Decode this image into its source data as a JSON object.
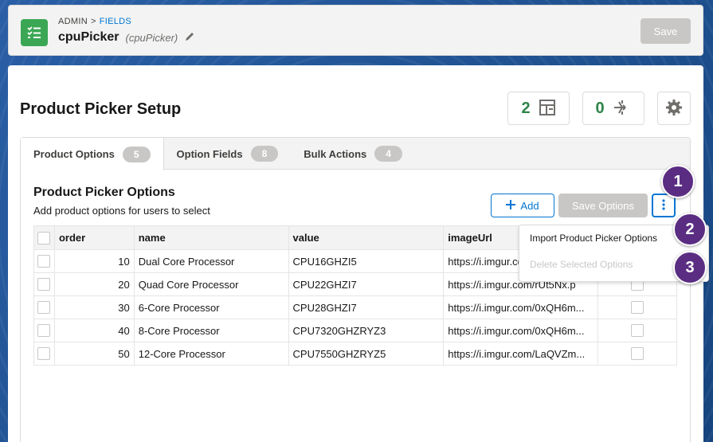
{
  "header": {
    "breadcrumb_root": "ADMIN",
    "breadcrumb_sep": ">",
    "breadcrumb_current": "FIELDS",
    "title": "cpuPicker",
    "api_name": "(cpuPicker)",
    "save_label": "Save"
  },
  "card": {
    "title": "Product Picker Setup",
    "stat_layout": "2",
    "stat_flows": "0"
  },
  "tabs": [
    {
      "label": "Product Options",
      "count": "5"
    },
    {
      "label": "Option Fields",
      "count": "8"
    },
    {
      "label": "Bulk Actions",
      "count": "4"
    }
  ],
  "section": {
    "title": "Product Picker Options",
    "subtitle": "Add product options for users to select",
    "add_label": "Add",
    "save_label": "Save Options"
  },
  "table": {
    "columns": [
      "order",
      "name",
      "value",
      "imageUrl"
    ],
    "rows": [
      {
        "order": "10",
        "name": "Dual Core Processor",
        "value": "CPU16GHZI5",
        "imageUrl": "https://i.imgur.com/"
      },
      {
        "order": "20",
        "name": "Quad Core Processor",
        "value": "CPU22GHZI7",
        "imageUrl": "https://i.imgur.com/rUt5Nx.p"
      },
      {
        "order": "30",
        "name": "6-Core Processor",
        "value": "CPU28GHZI7",
        "imageUrl": "https://i.imgur.com/0xQH6m..."
      },
      {
        "order": "40",
        "name": "8-Core Processor",
        "value": "CPU7320GHZRYZ3",
        "imageUrl": "https://i.imgur.com/0xQH6m..."
      },
      {
        "order": "50",
        "name": "12-Core Processor",
        "value": "CPU7550GHZRYZ5",
        "imageUrl": "https://i.imgur.com/LaQVZm..."
      }
    ]
  },
  "menu": {
    "import_label": "Import Product Picker Options",
    "delete_label": "Delete Selected Options"
  },
  "markers": [
    "1",
    "2",
    "3"
  ],
  "colors": {
    "accent": "#0176d3",
    "success": "#2e844a",
    "marker": "#5a2d82"
  }
}
